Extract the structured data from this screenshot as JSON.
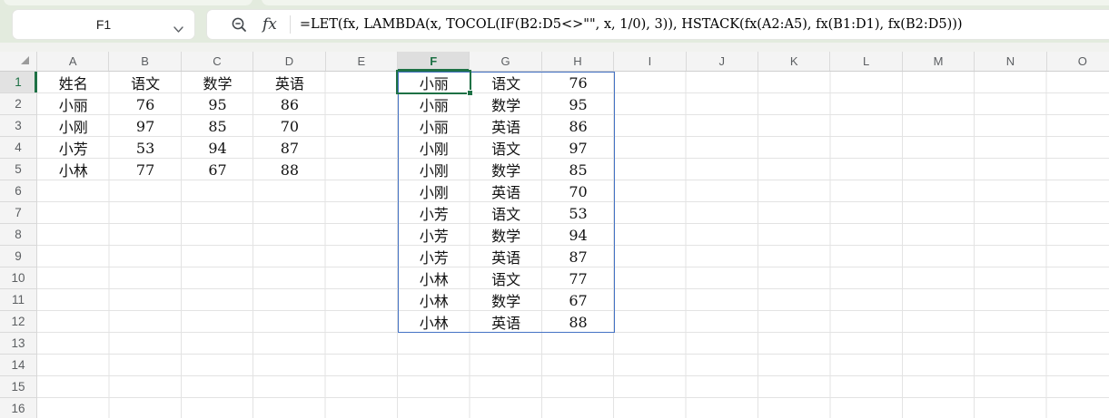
{
  "colors": {
    "accent_green": "#1e7145",
    "spill_border_blue": "#4472c4",
    "toolbar_background": "#e3ebde",
    "header_background": "#f4f4f4",
    "gridline": "#e3e3e3"
  },
  "toolbar": {
    "name_box_value": "F1",
    "fx_icon_label": "fx",
    "formula": "=LET(fx, LAMBDA(x, TOCOL(IF(B2:D5<>\"\", x, 1/0), 3)), HSTACK(fx(A2:A5), fx(B1:D1), fx(B2:D5)))"
  },
  "sheet": {
    "column_letters": [
      "A",
      "B",
      "C",
      "D",
      "E",
      "F",
      "G",
      "H",
      "I",
      "J",
      "K",
      "L",
      "M",
      "N",
      "O"
    ],
    "visible_row_count": 16,
    "selection": {
      "active_cell": "F1",
      "selected_column": "F",
      "selected_row": "1",
      "spill_range": "F1:H12"
    },
    "source_table": {
      "origin": "A1",
      "rows": [
        [
          "姓名",
          "语文",
          "数学",
          "英语"
        ],
        [
          "小丽",
          "76",
          "95",
          "86"
        ],
        [
          "小刚",
          "97",
          "85",
          "70"
        ],
        [
          "小芳",
          "53",
          "94",
          "87"
        ],
        [
          "小林",
          "77",
          "67",
          "88"
        ]
      ]
    },
    "spill_result": {
      "origin": "F1",
      "rows": [
        [
          "小丽",
          "语文",
          "76"
        ],
        [
          "小丽",
          "数学",
          "95"
        ],
        [
          "小丽",
          "英语",
          "86"
        ],
        [
          "小刚",
          "语文",
          "97"
        ],
        [
          "小刚",
          "数学",
          "85"
        ],
        [
          "小刚",
          "英语",
          "70"
        ],
        [
          "小芳",
          "语文",
          "53"
        ],
        [
          "小芳",
          "数学",
          "94"
        ],
        [
          "小芳",
          "英语",
          "87"
        ],
        [
          "小林",
          "语文",
          "77"
        ],
        [
          "小林",
          "数学",
          "67"
        ],
        [
          "小林",
          "英语",
          "88"
        ]
      ]
    }
  }
}
